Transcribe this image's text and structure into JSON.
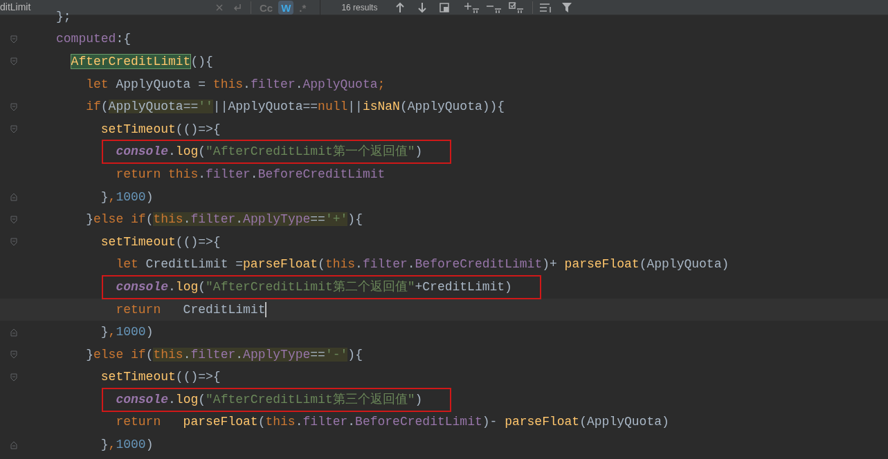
{
  "search_bar": {
    "query": "ditLimit",
    "toggles": [
      {
        "label": "Cc",
        "selected": false
      },
      {
        "label": "W",
        "selected": true
      },
      {
        "label": ".*",
        "selected": false
      }
    ],
    "results": "16 results"
  },
  "editor": {
    "lines": [
      {
        "tokens": [
          {
            "kind": "plain",
            "text": "};"
          }
        ]
      },
      {
        "fold_start": true,
        "tokens": [
          {
            "kind": "prop",
            "text": "computed"
          },
          {
            "kind": "plain",
            "text": ":{"
          }
        ],
        "children": [
          {
            "fold_start": true,
            "tokens": [
              {
                "kind": "fn",
                "text": "AfterCreditLimit",
                "selected_occurrence": true
              },
              {
                "kind": "plain",
                "text": "(){"
              }
            ],
            "children": [
              {
                "tokens": [
                  {
                    "kind": "kw",
                    "text": "let "
                  },
                  {
                    "kind": "plain",
                    "text": "ApplyQuota = "
                  },
                  {
                    "kind": "kw",
                    "text": "this"
                  },
                  {
                    "kind": "plain",
                    "text": "."
                  },
                  {
                    "kind": "prop",
                    "text": "filter"
                  },
                  {
                    "kind": "plain",
                    "text": "."
                  },
                  {
                    "kind": "prop",
                    "text": "ApplyQuota"
                  },
                  {
                    "kind": "kw",
                    "text": ";"
                  }
                ]
              },
              {
                "fold_start": true,
                "tokens": [
                  {
                    "kind": "kw",
                    "text": "if"
                  },
                  {
                    "kind": "plain",
                    "text": "("
                  },
                  {
                    "kind": "plain",
                    "text": "ApplyQuota==",
                    "search_match": true
                  },
                  {
                    "kind": "str",
                    "text": "''",
                    "search_match": true
                  },
                  {
                    "kind": "plain",
                    "text": "||ApplyQuota=="
                  },
                  {
                    "kind": "kw",
                    "text": "null"
                  },
                  {
                    "kind": "plain",
                    "text": "||"
                  },
                  {
                    "kind": "fn",
                    "text": "isNaN"
                  },
                  {
                    "kind": "plain",
                    "text": "(ApplyQuota)){"
                  }
                ],
                "children": [
                  {
                    "fold_start": true,
                    "tokens": [
                      {
                        "kind": "fn",
                        "text": "setTimeout"
                      },
                      {
                        "kind": "plain",
                        "text": "(()=>{"
                      }
                    ],
                    "children": [
                      {
                        "boxed": true,
                        "tokens": [
                          {
                            "kind": "ital",
                            "text": "console"
                          },
                          {
                            "kind": "plain",
                            "text": "."
                          },
                          {
                            "kind": "fn",
                            "text": "log"
                          },
                          {
                            "kind": "plain",
                            "text": "("
                          },
                          {
                            "kind": "str",
                            "text": "\"AfterCreditLimit第一个返回值\""
                          },
                          {
                            "kind": "plain",
                            "text": ")"
                          }
                        ]
                      },
                      {
                        "tokens": [
                          {
                            "kind": "kw",
                            "text": "return "
                          },
                          {
                            "kind": "kw",
                            "text": "this"
                          },
                          {
                            "kind": "plain",
                            "text": "."
                          },
                          {
                            "kind": "prop",
                            "text": "filter"
                          },
                          {
                            "kind": "plain",
                            "text": "."
                          },
                          {
                            "kind": "prop",
                            "text": "BeforeCreditLimit"
                          }
                        ]
                      }
                    ]
                  },
                  {
                    "fold_end": true,
                    "tokens": [
                      {
                        "kind": "plain",
                        "text": "}"
                      },
                      {
                        "kind": "kw",
                        "text": ","
                      },
                      {
                        "kind": "num",
                        "text": "1000"
                      },
                      {
                        "kind": "plain",
                        "text": ")"
                      }
                    ]
                  }
                ]
              },
              {
                "fold_start": true,
                "tokens": [
                  {
                    "kind": "plain",
                    "text": "}"
                  },
                  {
                    "kind": "kw",
                    "text": "else if"
                  },
                  {
                    "kind": "plain",
                    "text": "("
                  },
                  {
                    "kind": "kw",
                    "text": "this",
                    "search_match": true
                  },
                  {
                    "kind": "plain",
                    "text": ".",
                    "search_match": true
                  },
                  {
                    "kind": "prop",
                    "text": "filter",
                    "search_match": true
                  },
                  {
                    "kind": "plain",
                    "text": ".",
                    "search_match": true
                  },
                  {
                    "kind": "prop",
                    "text": "ApplyType",
                    "search_match": true
                  },
                  {
                    "kind": "plain",
                    "text": "==",
                    "search_match": true
                  },
                  {
                    "kind": "str",
                    "text": "'+'",
                    "search_match": true
                  },
                  {
                    "kind": "plain",
                    "text": "){"
                  }
                ],
                "children": [
                  {
                    "fold_start": true,
                    "tokens": [
                      {
                        "kind": "fn",
                        "text": "setTimeout"
                      },
                      {
                        "kind": "plain",
                        "text": "(()=>{"
                      }
                    ],
                    "children": [
                      {
                        "tokens": [
                          {
                            "kind": "kw",
                            "text": "let "
                          },
                          {
                            "kind": "plain",
                            "text": "CreditLimit ="
                          },
                          {
                            "kind": "fn",
                            "text": "parseFloat"
                          },
                          {
                            "kind": "plain",
                            "text": "("
                          },
                          {
                            "kind": "kw",
                            "text": "this"
                          },
                          {
                            "kind": "plain",
                            "text": "."
                          },
                          {
                            "kind": "prop",
                            "text": "filter"
                          },
                          {
                            "kind": "plain",
                            "text": "."
                          },
                          {
                            "kind": "prop",
                            "text": "BeforeCreditLimit"
                          },
                          {
                            "kind": "plain",
                            "text": ")+ "
                          },
                          {
                            "kind": "fn",
                            "text": "parseFloat"
                          },
                          {
                            "kind": "plain",
                            "text": "(ApplyQuota)"
                          }
                        ]
                      },
                      {
                        "boxed": true,
                        "tokens": [
                          {
                            "kind": "ital",
                            "text": "console"
                          },
                          {
                            "kind": "plain",
                            "text": "."
                          },
                          {
                            "kind": "fn",
                            "text": "log"
                          },
                          {
                            "kind": "plain",
                            "text": "("
                          },
                          {
                            "kind": "str",
                            "text": "\"AfterCreditLimit第二个返回值\""
                          },
                          {
                            "kind": "plain",
                            "text": "+CreditLimit)"
                          }
                        ]
                      },
                      {
                        "current": true,
                        "cursor": true,
                        "tokens": [
                          {
                            "kind": "kw",
                            "text": "return   "
                          },
                          {
                            "kind": "plain",
                            "text": "CreditLimit"
                          }
                        ]
                      }
                    ]
                  },
                  {
                    "fold_end": true,
                    "tokens": [
                      {
                        "kind": "plain",
                        "text": "}"
                      },
                      {
                        "kind": "kw",
                        "text": ","
                      },
                      {
                        "kind": "num",
                        "text": "1000"
                      },
                      {
                        "kind": "plain",
                        "text": ")"
                      }
                    ]
                  }
                ]
              },
              {
                "fold_start": true,
                "tokens": [
                  {
                    "kind": "plain",
                    "text": "}"
                  },
                  {
                    "kind": "kw",
                    "text": "else if"
                  },
                  {
                    "kind": "plain",
                    "text": "("
                  },
                  {
                    "kind": "kw",
                    "text": "this",
                    "search_match": true
                  },
                  {
                    "kind": "plain",
                    "text": ".",
                    "search_match": true
                  },
                  {
                    "kind": "prop",
                    "text": "filter",
                    "search_match": true
                  },
                  {
                    "kind": "plain",
                    "text": ".",
                    "search_match": true
                  },
                  {
                    "kind": "prop",
                    "text": "ApplyType",
                    "search_match": true
                  },
                  {
                    "kind": "plain",
                    "text": "==",
                    "search_match": true
                  },
                  {
                    "kind": "str",
                    "text": "'-'",
                    "search_match": true
                  },
                  {
                    "kind": "plain",
                    "text": "){"
                  }
                ],
                "children": [
                  {
                    "fold_start": true,
                    "tokens": [
                      {
                        "kind": "fn",
                        "text": "setTimeout"
                      },
                      {
                        "kind": "plain",
                        "text": "(()=>{"
                      }
                    ],
                    "children": [
                      {
                        "boxed": true,
                        "tokens": [
                          {
                            "kind": "ital",
                            "text": "console"
                          },
                          {
                            "kind": "plain",
                            "text": "."
                          },
                          {
                            "kind": "fn",
                            "text": "log"
                          },
                          {
                            "kind": "plain",
                            "text": "("
                          },
                          {
                            "kind": "str",
                            "text": "\"AfterCreditLimit第三个返回值\""
                          },
                          {
                            "kind": "plain",
                            "text": ")"
                          }
                        ]
                      },
                      {
                        "tokens": [
                          {
                            "kind": "kw",
                            "text": "return   "
                          },
                          {
                            "kind": "fn",
                            "text": "parseFloat"
                          },
                          {
                            "kind": "plain",
                            "text": "("
                          },
                          {
                            "kind": "kw",
                            "text": "this"
                          },
                          {
                            "kind": "plain",
                            "text": "."
                          },
                          {
                            "kind": "prop",
                            "text": "filter"
                          },
                          {
                            "kind": "plain",
                            "text": "."
                          },
                          {
                            "kind": "prop",
                            "text": "BeforeCreditLimit"
                          },
                          {
                            "kind": "plain",
                            "text": ")- "
                          },
                          {
                            "kind": "fn",
                            "text": "parseFloat"
                          },
                          {
                            "kind": "plain",
                            "text": "(ApplyQuota)"
                          }
                        ]
                      }
                    ]
                  },
                  {
                    "fold_end": true,
                    "tokens": [
                      {
                        "kind": "plain",
                        "text": "}"
                      },
                      {
                        "kind": "kw",
                        "text": ","
                      },
                      {
                        "kind": "num",
                        "text": "1000"
                      },
                      {
                        "kind": "plain",
                        "text": ")"
                      }
                    ]
                  }
                ]
              }
            ]
          }
        ]
      }
    ]
  }
}
